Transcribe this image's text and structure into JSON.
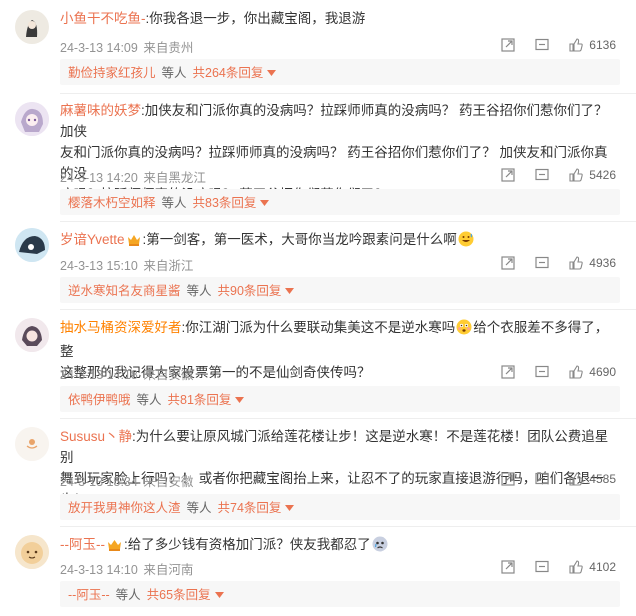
{
  "comments": [
    {
      "username": "小鱼干不吃鱼-",
      "text": ":你我各退一步，你出藏宝阁，我退游",
      "date": "24-3-13 14:09",
      "location": "来自贵州",
      "likes": "6136",
      "reply_user": "勤俭持家红孩儿",
      "reply_mid": "等人",
      "reply_count": "共264条回复"
    },
    {
      "username": "麻薯味的妖梦",
      "text_line1": ":加侠友和门派你真的没病吗？拉踩师师真的没病吗？ 药王谷招你们惹你们了？ 加侠",
      "text_line2": "友和门派你真的没病吗？拉踩师师真的没病吗？ 药王谷招你们惹你们了？ 加侠友和门派你真的没",
      "text_line3": "病吗？拉踩师师真的没病吗？ 药王谷招你们惹你们了？",
      "date": "24-3-13 14:20",
      "location": "来自黑龙江",
      "likes": "5426",
      "reply_user": "樱落木朽空如释",
      "reply_mid": "等人",
      "reply_count": "共83条回复"
    },
    {
      "username": "岁谙Yvette",
      "text": ":第一剑客，第一医术，大哥你当龙吟跟素问是什么啊",
      "date": "24-3-13 15:10",
      "location": "来自浙江",
      "likes": "4936",
      "reply_user": "逆水寒知名友商星酱",
      "reply_mid": "等人",
      "reply_count": "共90条回复"
    },
    {
      "username": "抽水马桶资深爱好者",
      "text_line1": ":你江湖门派为什么要联动集美这不是逆水寒吗",
      "text_line1b": "给个衣服差不多得了，整",
      "text_line2": "这整那的我记得大家投票第一的不是仙剑奇侠传吗？",
      "date": "24-3-13 14:18",
      "location": "来自安徽",
      "likes": "4690",
      "reply_user": "依鸭伊鸭哦",
      "reply_mid": "等人",
      "reply_count": "共81条回复"
    },
    {
      "username": "Sususu丶静",
      "text_line1": ":为什么要让原风城门派给莲花楼让步！这是逆水寒！不是莲花楼！团队公费追星别",
      "text_line2": "舞到玩家脸上行吗？！ 或者你把藏宝阁抬上来，让忍不了的玩家直接退游行吗，咱们各退一步！",
      "date": "24-3-13 15:34",
      "location": "来自安徽",
      "likes": "4585",
      "reply_user": "放开我男神你这人渣",
      "reply_mid": "等人",
      "reply_count": "共74条回复"
    },
    {
      "username": "--阿玉--",
      "text": ":给了多少钱有资格加门派？侠友我都忍了",
      "date": "24-3-13 14:10",
      "location": "来自河南",
      "likes": "4102",
      "reply_user": "--阿玉--",
      "reply_mid": "等人",
      "reply_count": "共65条回复"
    }
  ],
  "icons": {
    "share": "share-icon",
    "comment": "comment-icon",
    "like": "thumbs-up-icon",
    "crown": "crown-badge-icon",
    "arrow": "caret-down-icon"
  },
  "colors": {
    "username": "#eb7350",
    "meta": "#939393",
    "reply_bg": "#f7f7f7"
  }
}
